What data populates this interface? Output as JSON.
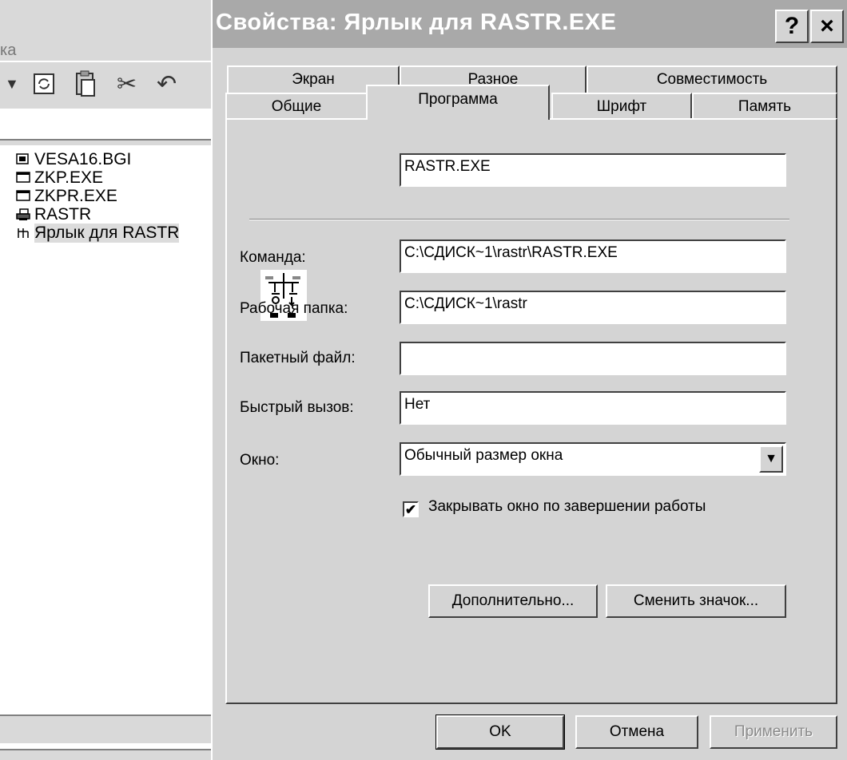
{
  "explorer": {
    "menu_text": "ка",
    "files": [
      {
        "name": "VESA16.BGI",
        "icon": "settings-file-icon"
      },
      {
        "name": "ZKP.EXE",
        "icon": "window-app-icon"
      },
      {
        "name": "ZKPR.EXE",
        "icon": "window-app-icon"
      },
      {
        "name": "RASTR",
        "icon": "printer-pif-icon"
      },
      {
        "name": "Ярлык для RASTR",
        "icon": "shortcut-icon",
        "selected": true
      }
    ]
  },
  "dialog": {
    "title": "Свойства: Ярлык для RASTR.EXE",
    "help_label": "?",
    "close_label": "×",
    "tabs_back": [
      "Экран",
      "Разное",
      "Совместимость"
    ],
    "tabs_front": [
      "Общие",
      "Программа",
      "Шрифт",
      "Память"
    ],
    "active_tab": "Программа",
    "program": {
      "name_value": "RASTR.EXE",
      "command_label": "Команда:",
      "command_value": "C:\\СДИСК~1\\rastr\\RASTR.EXE",
      "workdir_label": "Рабочая папка:",
      "workdir_value": "C:\\СДИСК~1\\rastr",
      "batch_label": "Пакетный файл:",
      "batch_value": "",
      "hotkey_label": "Быстрый вызов:",
      "hotkey_value": "Нет",
      "window_label": "Окно:",
      "window_value": "Обычный размер окна",
      "close_on_exit_label": "Закрывать окно по завершении работы",
      "close_on_exit_checked": true,
      "advanced_button": "Дополнительно...",
      "change_icon_button": "Сменить значок..."
    },
    "buttons": {
      "ok": "OK",
      "cancel": "Отмена",
      "apply": "Применить"
    }
  }
}
